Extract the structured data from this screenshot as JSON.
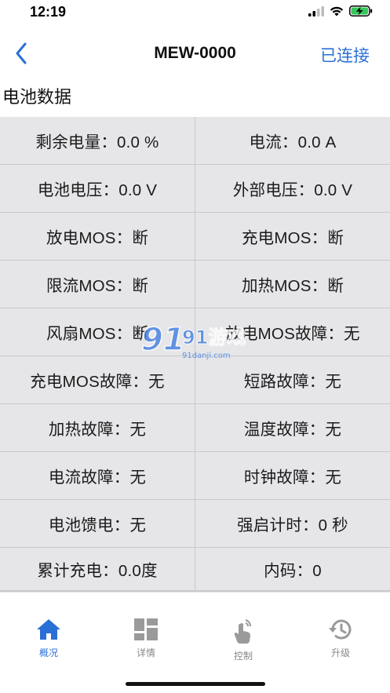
{
  "status": {
    "time": "12:19",
    "icons": [
      "signal-icon",
      "wifi-icon",
      "battery-charging-icon"
    ]
  },
  "nav": {
    "back_icon": "chevron-left-icon",
    "title": "MEW-0000",
    "action": "已连接"
  },
  "section": {
    "title": "电池数据"
  },
  "grid": {
    "cells": [
      "剩余电量：0.0 %",
      "电流：0.0 A",
      "电池电压：0.0 V",
      "外部电压：0.0 V",
      "放电MOS：断",
      "充电MOS：断",
      "限流MOS：断",
      "加热MOS：断",
      "风扇MOS：断",
      "放电MOS故障：无",
      "充电MOS故障：无",
      "短路故障：无",
      "加热故障：无",
      "温度故障：无",
      "电流故障：无",
      "时钟故障：无",
      "电池馈电：无",
      "强启计时：0 秒",
      "累计充电：0.0度",
      "内码：0"
    ]
  },
  "watermark": {
    "text": "91游戏",
    "subtext": "91danji.com"
  },
  "tabs": [
    {
      "label": "概况",
      "icon": "home-icon",
      "active": true
    },
    {
      "label": "详情",
      "icon": "grid-icon",
      "active": false
    },
    {
      "label": "控制",
      "icon": "touch-icon",
      "active": false
    },
    {
      "label": "升级",
      "icon": "history-icon",
      "active": false
    }
  ],
  "colors": {
    "accent": "#2a6fd6",
    "cell_bg": "#e6e6e9",
    "divider": "#c9c9cd",
    "battery": "#34c759"
  }
}
